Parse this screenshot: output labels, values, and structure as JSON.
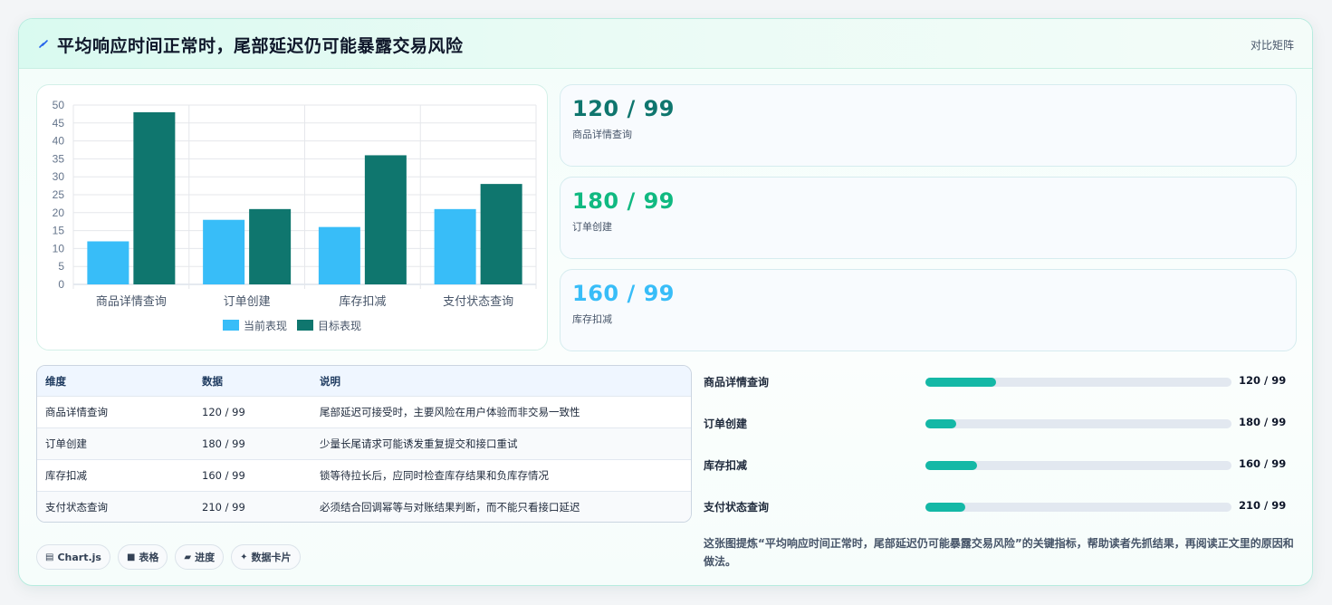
{
  "header": {
    "title": "平均响应时间正常时，尾部延迟仍可能暴露交易风险",
    "tag": "对比矩阵",
    "icon": "lightning-icon"
  },
  "colors": {
    "current": "#38bdf8",
    "target": "#0f766e",
    "kpi1": "#0f766e",
    "kpi2": "#10b981",
    "kpi3": "#38bdf8",
    "progress": "#14b8a6"
  },
  "chart_data": {
    "type": "bar",
    "categories": [
      "商品详情查询",
      "订单创建",
      "库存扣减",
      "支付状态查询"
    ],
    "series": [
      {
        "name": "当前表现",
        "values": [
          12,
          18,
          16,
          21
        ]
      },
      {
        "name": "目标表现",
        "values": [
          48,
          21,
          36,
          28
        ]
      }
    ],
    "ylim": [
      0,
      50
    ],
    "yticks": [
      0,
      5,
      10,
      15,
      20,
      25,
      30,
      35,
      40,
      45,
      50
    ],
    "grid": true,
    "legend": "bottom"
  },
  "kpis": [
    {
      "value": "120 / 99",
      "label": "商品详情查询"
    },
    {
      "value": "180 / 99",
      "label": "订单创建"
    },
    {
      "value": "160 / 99",
      "label": "库存扣减"
    }
  ],
  "table": {
    "headers": [
      "维度",
      "数据",
      "说明"
    ],
    "rows": [
      [
        "商品详情查询",
        "120 / 99",
        "尾部延迟可接受时，主要风险在用户体验而非交易一致性"
      ],
      [
        "订单创建",
        "180 / 99",
        "少量长尾请求可能诱发重复提交和接口重试"
      ],
      [
        "库存扣减",
        "160 / 99",
        "锁等待拉长后，应同时检查库存结果和负库存情况"
      ],
      [
        "支付状态查询",
        "210 / 99",
        "必须结合回调幂等与对账结果判断，而不能只看接口延迟"
      ]
    ]
  },
  "progress": [
    {
      "label": "商品详情查询",
      "value": "120 / 99",
      "fill": 0.23
    },
    {
      "label": "订单创建",
      "value": "180 / 99",
      "fill": 0.1
    },
    {
      "label": "库存扣减",
      "value": "160 / 99",
      "fill": 0.17
    },
    {
      "label": "支付状态查询",
      "value": "210 / 99",
      "fill": 0.13
    }
  ],
  "chips": [
    {
      "icon": "▤",
      "label": "Chart.js"
    },
    {
      "icon": "■",
      "label": "表格"
    },
    {
      "icon": "▰",
      "label": "进度"
    },
    {
      "icon": "✦",
      "label": "数据卡片"
    }
  ],
  "summary": "这张图提炼“平均响应时间正常时，尾部延迟仍可能暴露交易风险”的关键指标，帮助读者先抓结果，再阅读正文里的原因和做法。"
}
